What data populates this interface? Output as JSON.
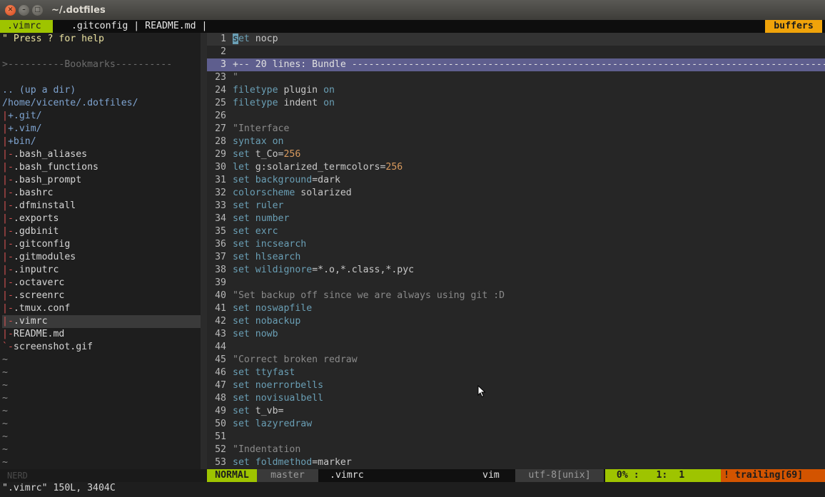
{
  "window": {
    "title": "~/.dotfiles"
  },
  "tabline": {
    "active_tab": ".vimrc",
    "other_tabs": " .gitconfig | README.md |",
    "buffers_label": "buffers"
  },
  "tree": {
    "help": "\" Press ? for help",
    "bookmarks": ">----------Bookmarks----------",
    "up_dir": ".. (up a dir)",
    "root": "/home/vicente/.dotfiles/",
    "dirs": [
      "+.git/",
      "+.vim/",
      "+bin/"
    ],
    "files": [
      ".bash_aliases",
      ".bash_functions",
      ".bash_prompt",
      ".bashrc",
      ".dfminstall",
      ".exports",
      ".gdbinit",
      ".gitconfig",
      ".gitmodules",
      ".inputrc",
      ".octaverc",
      ".screenrc",
      ".tmux.conf",
      ".vimrc",
      "README.md",
      "screenshot.gif"
    ],
    "selected_file": ".vimrc",
    "tilde": "~",
    "status_label": "NERD"
  },
  "editor": {
    "lines": [
      {
        "n": "1",
        "parts": [
          {
            "t": "set",
            "c": "kw"
          },
          {
            "t": " nocp",
            "c": "code"
          }
        ]
      },
      {
        "n": "2",
        "parts": []
      },
      {
        "n": "3",
        "fold": "+-- 20 lines: Bundle ------------------------------------------------------------------------------------"
      },
      {
        "n": "23",
        "parts": [
          {
            "t": "\"",
            "c": "cm"
          }
        ]
      },
      {
        "n": "24",
        "parts": [
          {
            "t": "filetype",
            "c": "kw"
          },
          {
            "t": " plugin ",
            "c": "code"
          },
          {
            "t": "on",
            "c": "kw"
          }
        ]
      },
      {
        "n": "25",
        "parts": [
          {
            "t": "filetype",
            "c": "kw"
          },
          {
            "t": " indent ",
            "c": "code"
          },
          {
            "t": "on",
            "c": "kw"
          }
        ]
      },
      {
        "n": "26",
        "parts": []
      },
      {
        "n": "27",
        "parts": [
          {
            "t": "\"Interface",
            "c": "cm"
          }
        ]
      },
      {
        "n": "28",
        "parts": [
          {
            "t": "syntax",
            "c": "kw"
          },
          {
            "t": " ",
            "c": "code"
          },
          {
            "t": "on",
            "c": "kw"
          }
        ]
      },
      {
        "n": "29",
        "parts": [
          {
            "t": "set",
            "c": "kw"
          },
          {
            "t": " t_Co=",
            "c": "code"
          },
          {
            "t": "256",
            "c": "num"
          }
        ]
      },
      {
        "n": "30",
        "parts": [
          {
            "t": "let",
            "c": "kw"
          },
          {
            "t": " g:solarized_termcolors=",
            "c": "code"
          },
          {
            "t": "256",
            "c": "num"
          }
        ]
      },
      {
        "n": "31",
        "parts": [
          {
            "t": "set",
            "c": "kw"
          },
          {
            "t": " ",
            "c": "code"
          },
          {
            "t": "background",
            "c": "kw"
          },
          {
            "t": "=dark",
            "c": "code"
          }
        ]
      },
      {
        "n": "32",
        "parts": [
          {
            "t": "colorscheme",
            "c": "kw"
          },
          {
            "t": " solarized",
            "c": "code"
          }
        ]
      },
      {
        "n": "33",
        "parts": [
          {
            "t": "set",
            "c": "kw"
          },
          {
            "t": " ",
            "c": "code"
          },
          {
            "t": "ruler",
            "c": "kw"
          }
        ]
      },
      {
        "n": "34",
        "parts": [
          {
            "t": "set",
            "c": "kw"
          },
          {
            "t": " ",
            "c": "code"
          },
          {
            "t": "number",
            "c": "kw"
          }
        ]
      },
      {
        "n": "35",
        "parts": [
          {
            "t": "set",
            "c": "kw"
          },
          {
            "t": " ",
            "c": "code"
          },
          {
            "t": "exrc",
            "c": "kw"
          }
        ]
      },
      {
        "n": "36",
        "parts": [
          {
            "t": "set",
            "c": "kw"
          },
          {
            "t": " ",
            "c": "code"
          },
          {
            "t": "incsearch",
            "c": "kw"
          }
        ]
      },
      {
        "n": "37",
        "parts": [
          {
            "t": "set",
            "c": "kw"
          },
          {
            "t": " ",
            "c": "code"
          },
          {
            "t": "hlsearch",
            "c": "kw"
          }
        ]
      },
      {
        "n": "38",
        "parts": [
          {
            "t": "set",
            "c": "kw"
          },
          {
            "t": " ",
            "c": "code"
          },
          {
            "t": "wildignore",
            "c": "kw"
          },
          {
            "t": "=*.o,*.class,*.pyc",
            "c": "code"
          }
        ]
      },
      {
        "n": "39",
        "parts": []
      },
      {
        "n": "40",
        "parts": [
          {
            "t": "\"Set backup off since we are always using git :D",
            "c": "cm"
          }
        ]
      },
      {
        "n": "41",
        "parts": [
          {
            "t": "set",
            "c": "kw"
          },
          {
            "t": " ",
            "c": "code"
          },
          {
            "t": "noswapfile",
            "c": "kw"
          }
        ]
      },
      {
        "n": "42",
        "parts": [
          {
            "t": "set",
            "c": "kw"
          },
          {
            "t": " ",
            "c": "code"
          },
          {
            "t": "nobackup",
            "c": "kw"
          }
        ]
      },
      {
        "n": "43",
        "parts": [
          {
            "t": "set",
            "c": "kw"
          },
          {
            "t": " ",
            "c": "code"
          },
          {
            "t": "nowb",
            "c": "kw"
          }
        ]
      },
      {
        "n": "44",
        "parts": []
      },
      {
        "n": "45",
        "parts": [
          {
            "t": "\"Correct broken redraw",
            "c": "cm"
          }
        ]
      },
      {
        "n": "46",
        "parts": [
          {
            "t": "set",
            "c": "kw"
          },
          {
            "t": " ",
            "c": "code"
          },
          {
            "t": "ttyfast",
            "c": "kw"
          }
        ]
      },
      {
        "n": "47",
        "parts": [
          {
            "t": "set",
            "c": "kw"
          },
          {
            "t": " ",
            "c": "code"
          },
          {
            "t": "noerrorbells",
            "c": "kw"
          }
        ]
      },
      {
        "n": "48",
        "parts": [
          {
            "t": "set",
            "c": "kw"
          },
          {
            "t": " ",
            "c": "code"
          },
          {
            "t": "novisualbell",
            "c": "kw"
          }
        ]
      },
      {
        "n": "49",
        "parts": [
          {
            "t": "set",
            "c": "kw"
          },
          {
            "t": " t_vb=",
            "c": "code"
          }
        ]
      },
      {
        "n": "50",
        "parts": [
          {
            "t": "set",
            "c": "kw"
          },
          {
            "t": " ",
            "c": "code"
          },
          {
            "t": "lazyredraw",
            "c": "kw"
          }
        ]
      },
      {
        "n": "51",
        "parts": []
      },
      {
        "n": "52",
        "parts": [
          {
            "t": "\"Indentation",
            "c": "cm"
          }
        ]
      },
      {
        "n": "53",
        "parts": [
          {
            "t": "set",
            "c": "kw"
          },
          {
            "t": " ",
            "c": "code"
          },
          {
            "t": "foldmethod",
            "c": "kw"
          },
          {
            "t": "=marker",
            "c": "code"
          }
        ]
      }
    ]
  },
  "statusline": {
    "mode": "NORMAL",
    "branch": "master",
    "filename": ".vimrc",
    "filetype": "vim",
    "encoding": "utf-8[unix]",
    "position": "  0% :   1:  1",
    "warning": "! trailing[69]"
  },
  "cmdline": "\".vimrc\" 150L, 3404C",
  "colors": {
    "accent_green": "#9ec400",
    "accent_orange": "#f0a30a",
    "warning_orange": "#d35400",
    "fold_bg": "#5e5e8e"
  }
}
